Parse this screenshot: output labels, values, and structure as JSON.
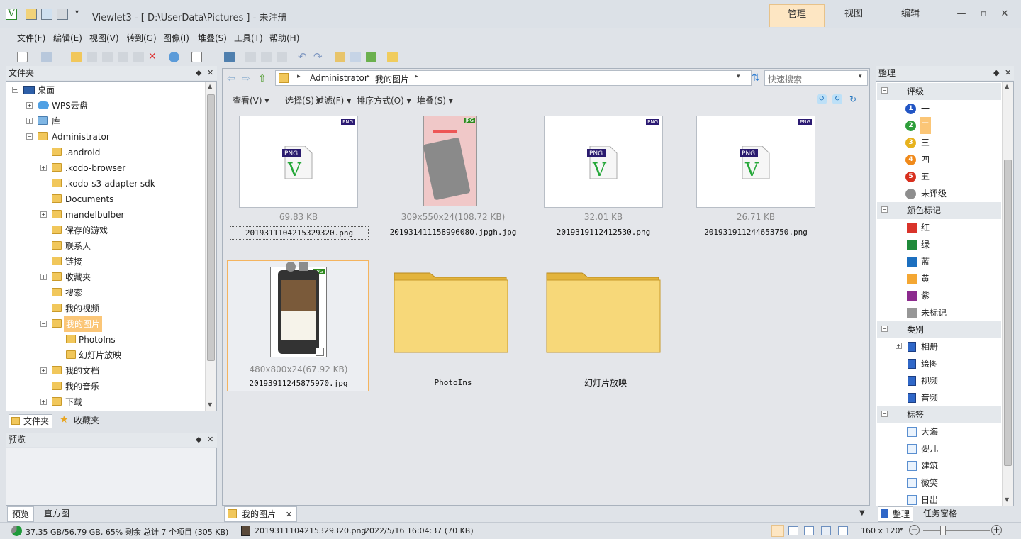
{
  "app": {
    "title": "Viewlet3 - [ D:\\UserData\\Pictures ] - 未注册"
  },
  "ribbon_tabs": [
    {
      "label": "管理"
    },
    {
      "label": "视图"
    },
    {
      "label": "编辑"
    }
  ],
  "menu": [
    {
      "label": "文件(F)"
    },
    {
      "label": "编辑(E)"
    },
    {
      "label": "视图(V)"
    },
    {
      "label": "转到(G)"
    },
    {
      "label": "图像(I)"
    },
    {
      "label": "堆叠(S)"
    },
    {
      "label": "工具(T)"
    },
    {
      "label": "帮助(H)"
    }
  ],
  "folder_panel": {
    "title": "文件夹",
    "tree": [
      {
        "label": "桌面"
      },
      {
        "label": "WPS云盘"
      },
      {
        "label": "库"
      },
      {
        "label": "Administrator"
      },
      {
        "label": ".android"
      },
      {
        "label": ".kodo-browser"
      },
      {
        "label": ".kodo-s3-adapter-sdk"
      },
      {
        "label": "Documents"
      },
      {
        "label": "mandelbulber"
      },
      {
        "label": "保存的游戏"
      },
      {
        "label": "联系人"
      },
      {
        "label": "链接"
      },
      {
        "label": "收藏夹"
      },
      {
        "label": "搜索"
      },
      {
        "label": "我的视频"
      },
      {
        "label": "我的图片"
      },
      {
        "label": "PhotoIns"
      },
      {
        "label": "幻灯片放映"
      },
      {
        "label": "我的文档"
      },
      {
        "label": "我的音乐"
      },
      {
        "label": "下载"
      }
    ],
    "tabs": [
      {
        "label": "文件夹"
      },
      {
        "label": "收藏夹"
      }
    ]
  },
  "preview_panel": {
    "title": "预览",
    "tabs": [
      {
        "label": "预览"
      },
      {
        "label": "直方图"
      }
    ]
  },
  "address": {
    "crumbs": [
      "Administrator",
      "我的图片"
    ]
  },
  "search": {
    "placeholder": "快速搜索"
  },
  "filterbar": [
    {
      "label": "查看(V)"
    },
    {
      "label": "选择(S)"
    },
    {
      "label": "过滤(F)"
    },
    {
      "label": "排序方式(O)"
    },
    {
      "label": "堆叠(S)"
    }
  ],
  "items": [
    {
      "size": "69.83 KB",
      "name": "2019311104215329320.png",
      "badge": "PNG"
    },
    {
      "size": "309x550x24(108.72 KB)",
      "name": "201931411158996080.jpgh.jpg",
      "badge": "JPG"
    },
    {
      "size": "32.01 KB",
      "name": "201931911241253​0.png",
      "badge": "PNG"
    },
    {
      "size": "26.71 KB",
      "name": "201931911244653750.png",
      "badge": "PNG"
    },
    {
      "size": "480x800x24(67.92 KB)",
      "name": "2019391124587​5970.jpg",
      "badge": "JPG"
    },
    {
      "size": "",
      "name": "PhotoIns",
      "badge": ""
    },
    {
      "size": "",
      "name": "幻灯片放映",
      "badge": ""
    }
  ],
  "content_tab": {
    "label": "我的图片"
  },
  "organize": {
    "title": "整理",
    "sections": [
      {
        "label": "评级",
        "rows": [
          {
            "label": "一",
            "num": "1",
            "color": "#2255c4"
          },
          {
            "label": "二",
            "num": "2",
            "color": "#2e9e3a"
          },
          {
            "label": "三",
            "num": "3",
            "color": "#e7b21d"
          },
          {
            "label": "四",
            "num": "4",
            "color": "#f08a1b"
          },
          {
            "label": "五",
            "num": "5",
            "color": "#d8301e"
          },
          {
            "label": "未评级",
            "num": "",
            "color": "#8e8e8e"
          }
        ]
      },
      {
        "label": "颜色标记",
        "rows": [
          {
            "label": "红",
            "color": "#d9342b"
          },
          {
            "label": "绿",
            "color": "#1f8a3a"
          },
          {
            "label": "蓝",
            "color": "#1c6fbf"
          },
          {
            "label": "黄",
            "color": "#f4a733"
          },
          {
            "label": "紫",
            "color": "#8c2a8e"
          },
          {
            "label": "未标记",
            "color": "#979797"
          }
        ]
      },
      {
        "label": "类别",
        "rows": [
          {
            "label": "相册"
          },
          {
            "label": "绘图"
          },
          {
            "label": "视频"
          },
          {
            "label": "音频"
          }
        ]
      },
      {
        "label": "标签",
        "rows": [
          {
            "label": "大海"
          },
          {
            "label": "婴儿"
          },
          {
            "label": "建筑"
          },
          {
            "label": "微笑"
          },
          {
            "label": "日出"
          }
        ]
      }
    ],
    "tabs": [
      {
        "label": "整理"
      },
      {
        "label": "任务窗格"
      }
    ]
  },
  "status": {
    "disk": "37.35 GB/56.79 GB, 65% 剩余",
    "total": "总计 7 个项目 (305 KB)",
    "file": "2019311104215329320.png",
    "date": "2022/5/16 16:04:37 (70 KB)",
    "thumb_size": "160 x 120"
  }
}
